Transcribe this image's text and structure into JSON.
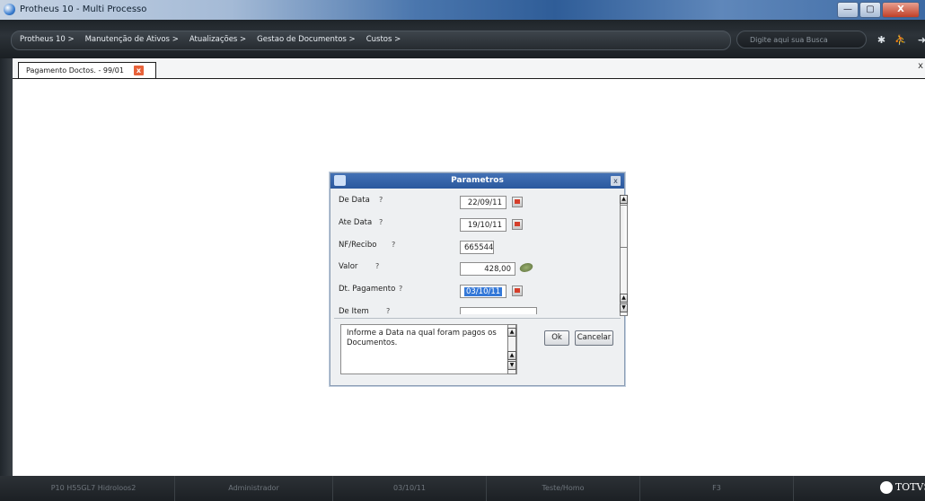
{
  "window": {
    "title": "Protheus 10 - Multi Processo",
    "buttons": {
      "minimize": "—",
      "maximize": "▢",
      "close": "X"
    }
  },
  "menubar": {
    "items": [
      "Protheus 10 >",
      "Manutenção de Ativos >",
      "Atualizações >",
      "Gestao de Documentos >",
      "Custos >"
    ],
    "search_placeholder": "Digite aqui sua Busca"
  },
  "tab": {
    "label": "Pagamento Doctos. - 99/01",
    "close": "x",
    "panel_close": "x"
  },
  "dialog": {
    "title": "Parametros",
    "close": "x",
    "params": [
      {
        "label": "De Data",
        "q": "?",
        "value": "22/09/11",
        "icon": "calendar-icon"
      },
      {
        "label": "Ate Data",
        "q": "?",
        "value": "19/10/11",
        "icon": "calendar-icon"
      },
      {
        "label": "NF/Recibo",
        "q": "?",
        "value": "665544",
        "icon": ""
      },
      {
        "label": "Valor",
        "q": "?",
        "value": "428,00",
        "icon": "calculator-icon"
      },
      {
        "label": "Dt. Pagamento",
        "q": "?",
        "value": "03/10/11",
        "icon": "calendar-icon"
      },
      {
        "label": "De Item",
        "q": "?",
        "value": "",
        "icon": ""
      }
    ],
    "help_text": "Informe a Data na qual foram pagos os Documentos.",
    "ok_label": "Ok",
    "cancel_label": "Cancelar"
  },
  "statusbar": {
    "cells": [
      "P10 H55GL7 Hidroloos2",
      "Administrador",
      "03/10/11",
      "Teste/Homo",
      "F3"
    ],
    "logo_text": "TOTVS"
  }
}
